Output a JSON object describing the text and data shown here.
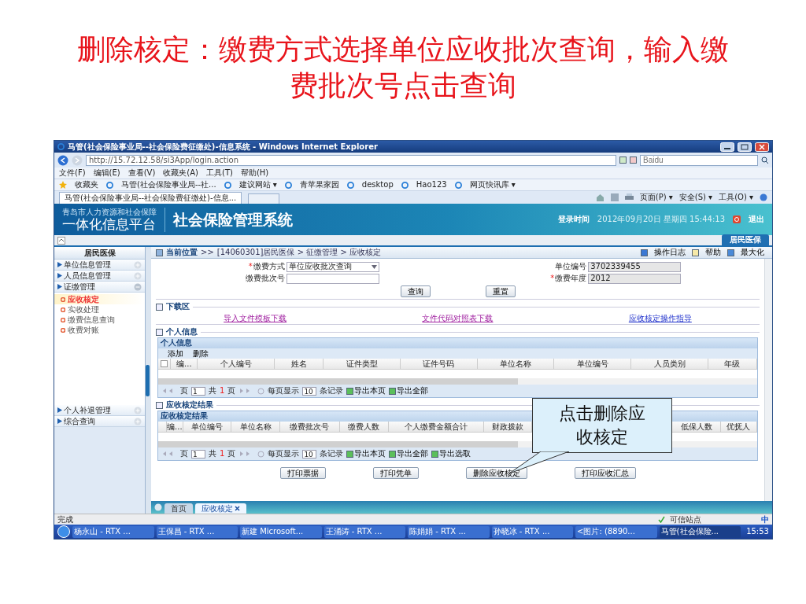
{
  "slide_title": "删除核定：缴费方式选择单位应收批次查询，输入缴费批次号点击查询",
  "browser": {
    "title": "马管(社会保险事业局--社会保险费征缴处)-信息系统 - Windows Internet Explorer",
    "address": "http://15.72.12.58/si3App/login.action",
    "search_placeholder": "Baidu",
    "menu": [
      "文件(F)",
      "编辑(E)",
      "查看(V)",
      "收藏夹(A)",
      "工具(T)",
      "帮助(H)"
    ],
    "favorites_label": "收藏夹",
    "favorites": [
      "马管(社会保险事业局--社...",
      "建议网站 ▾",
      "青苹果家园",
      "desktop",
      "Hao123",
      "网页快讯库 ▾"
    ],
    "page_tab": "马管(社会保险事业局--社会保险费征缴处)-信息...",
    "commands": [
      "页面(P) ▾",
      "安全(S) ▾",
      "工具(O) ▾"
    ]
  },
  "app": {
    "logo_top": "青岛市人力资源和社会保障",
    "logo_bottom": "一体化信息平台",
    "system_title": "社会保险管理系统",
    "login_label": "登录时间",
    "login_time": "2012年09月20日 星期四 15:44:13",
    "logout": "退出",
    "top_tabs": [
      {
        "label": "居民医保",
        "selected": true
      }
    ],
    "sidebar": {
      "title": "居民医保",
      "groups": [
        {
          "label": "单位信息管理",
          "expanded": false
        },
        {
          "label": "人员信息管理",
          "expanded": false
        },
        {
          "label": "证缴管理",
          "expanded": true,
          "children": [
            {
              "label": "应收核定",
              "selected": true
            },
            {
              "label": "实收处理",
              "selected": false
            },
            {
              "label": "缴费信息查询",
              "selected": false
            },
            {
              "label": "收费对账",
              "selected": false
            }
          ]
        },
        {
          "label": "个人补退管理",
          "expanded": false
        },
        {
          "label": "综合查询",
          "expanded": false
        }
      ]
    },
    "breadcrumb": {
      "label": "当前位置",
      "separator": ">>",
      "path": "[14060301]居民医保 > 征缴管理 > 应收核定"
    },
    "page_actions": [
      "操作日志",
      "帮助",
      "最大化"
    ],
    "form": {
      "left": [
        {
          "label": "缴费方式",
          "marker": "*",
          "kind": "select",
          "value": "单位应收批次查询"
        },
        {
          "label": "缴费批次号",
          "kind": "input"
        }
      ],
      "right": [
        {
          "label": "单位编号",
          "kind": "readonly",
          "value": "3702339455"
        },
        {
          "label": "缴费年度",
          "marker": "*",
          "kind": "readonly",
          "value": "2012"
        }
      ],
      "buttons": [
        "查询",
        "重置"
      ]
    },
    "download": {
      "legend": "下载区",
      "links": [
        {
          "label": "导入文件模板下载",
          "visited": true
        },
        {
          "label": "文件代码对照表下载",
          "visited": true
        },
        {
          "label": "应收核定操作指导",
          "visited": false
        }
      ]
    },
    "person_section": {
      "legend": "个人信息",
      "title": "个人信息",
      "toolbar": [
        "添加",
        "删除"
      ],
      "select_all": {
        "checked": false
      },
      "columns": [
        "编...",
        "个人编号",
        "姓名",
        "证件类型",
        "证件号码",
        "单位名称",
        "单位编号",
        "人员类别",
        "年级"
      ],
      "pager": {
        "page_label": "页",
        "page": "1",
        "total_prefix": "共",
        "total": "1",
        "total_suffix": "页",
        "per_page_label": "每页显示",
        "per_page": "10",
        "per_page_suffix": "条记录",
        "exports": [
          "导出本页",
          "导出全部"
        ]
      }
    },
    "result_section": {
      "legend": "应收核定结果",
      "title": "应收核定结果",
      "columns": [
        "编...",
        "单位编号",
        "单位名称",
        "缴费批次号",
        "缴费人数",
        "个人缴费金额合计",
        "财政拨款",
        "低保人数",
        "优抚人"
      ],
      "pager": {
        "page_label": "页",
        "page": "1",
        "total_prefix": "共",
        "total": "1",
        "total_suffix": "页",
        "per_page_label": "每页显示",
        "per_page": "10",
        "per_page_suffix": "条记录",
        "exports": [
          "导出本页",
          "导出全部",
          "导出选取"
        ]
      }
    },
    "actions": [
      "打印票据",
      "打印凭单",
      "删除应收核定",
      "打印应收汇总"
    ],
    "bottom_tabs": [
      {
        "label": "首页",
        "selected": false,
        "closable": false
      },
      {
        "label": "应收核定",
        "selected": true,
        "closable": true
      }
    ],
    "callout": "点击删除应收核定"
  },
  "status_bar": {
    "text": "完成",
    "zone": "可信站点",
    "ime": "中"
  },
  "taskbar": {
    "items": [
      {
        "label": "杨永山 - RTX ...",
        "selected": false
      },
      {
        "label": "王保昌 - RTX ...",
        "selected": false
      },
      {
        "label": "新建 Microsoft...",
        "selected": false
      },
      {
        "label": "王涌涛 - RTX ...",
        "selected": false
      },
      {
        "label": "陈娟娟 - RTX ...",
        "selected": false
      },
      {
        "label": "孙晓冰 - RTX ...",
        "selected": false
      },
      {
        "label": "<图片: (8890...",
        "selected": false
      },
      {
        "label": "马管(社会保险...",
        "selected": true
      }
    ],
    "time": "15:53"
  }
}
